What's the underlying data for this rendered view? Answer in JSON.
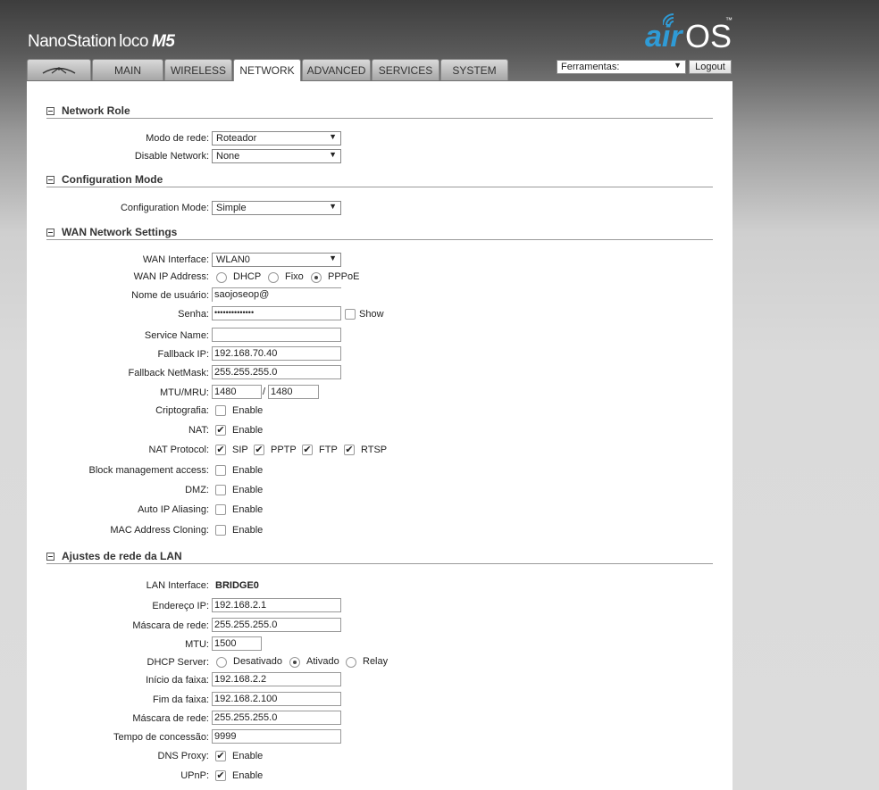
{
  "header": {
    "product": "NanoStation",
    "product_loco": "loco",
    "product_model": "M5",
    "logo_air": "air",
    "logo_os": "OS",
    "logo_tm": "™",
    "tools_select": "Ferramentas:",
    "logout": "Logout"
  },
  "tabs": [
    "",
    "MAIN",
    "WIRELESS",
    "NETWORK",
    "ADVANCED",
    "SERVICES",
    "SYSTEM"
  ],
  "network_role": {
    "title": "Network Role",
    "mode_label": "Modo de rede:",
    "mode_value": "Roteador",
    "disable_label": "Disable Network:",
    "disable_value": "None"
  },
  "config_mode": {
    "title": "Configuration Mode",
    "label": "Configuration Mode:",
    "value": "Simple"
  },
  "wan": {
    "title": "WAN Network Settings",
    "iface_label": "WAN Interface:",
    "iface_value": "WLAN0",
    "ip_label": "WAN IP Address:",
    "opt_dhcp": "DHCP",
    "opt_fixo": "Fixo",
    "opt_pppoe": "PPPoE",
    "user_label": "Nome de usuário:",
    "user_value": "saojoseop@",
    "pass_label": "Senha:",
    "pass_value": "••••••••••••••",
    "show_label": "Show",
    "service_label": "Service Name:",
    "service_value": "",
    "fallback_ip_label": "Fallback IP:",
    "fallback_ip_value": "192.168.70.40",
    "fallback_mask_label": "Fallback NetMask:",
    "fallback_mask_value": "255.255.255.0",
    "mtu_label": "MTU/MRU:",
    "mtu_value": "1480",
    "mtu_sep": "/",
    "mru_value": "1480",
    "crypt_label": "Criptografia:",
    "nat_label": "NAT:",
    "natproto_label": "NAT Protocol:",
    "proto_sip": "SIP",
    "proto_pptp": "PPTP",
    "proto_ftp": "FTP",
    "proto_rtsp": "RTSP",
    "block_label": "Block management access:",
    "dmz_label": "DMZ:",
    "alias_label": "Auto IP Aliasing:",
    "clone_label": "MAC Address Cloning:",
    "enable": "Enable"
  },
  "lan": {
    "title": "Ajustes de rede da LAN",
    "iface_label": "LAN Interface:",
    "iface_value": "BRIDGE0",
    "ip_label": "Endereço IP:",
    "ip_value": "192.168.2.1",
    "mask_label": "Máscara de rede:",
    "mask_value": "255.255.255.0",
    "mtu_label": "MTU:",
    "mtu_value": "1500",
    "dhcp_label": "DHCP Server:",
    "opt_off": "Desativado",
    "opt_on": "Ativado",
    "opt_relay": "Relay",
    "start_label": "Início da faixa:",
    "start_value": "192.168.2.2",
    "end_label": "Fim da faixa:",
    "end_value": "192.168.2.100",
    "mask2_label": "Máscara de rede:",
    "mask2_value": "255.255.255.0",
    "lease_label": "Tempo de concessão:",
    "lease_value": "9999",
    "dns_label": "DNS Proxy:",
    "upnp_label": "UPnP:",
    "enable": "Enable"
  }
}
